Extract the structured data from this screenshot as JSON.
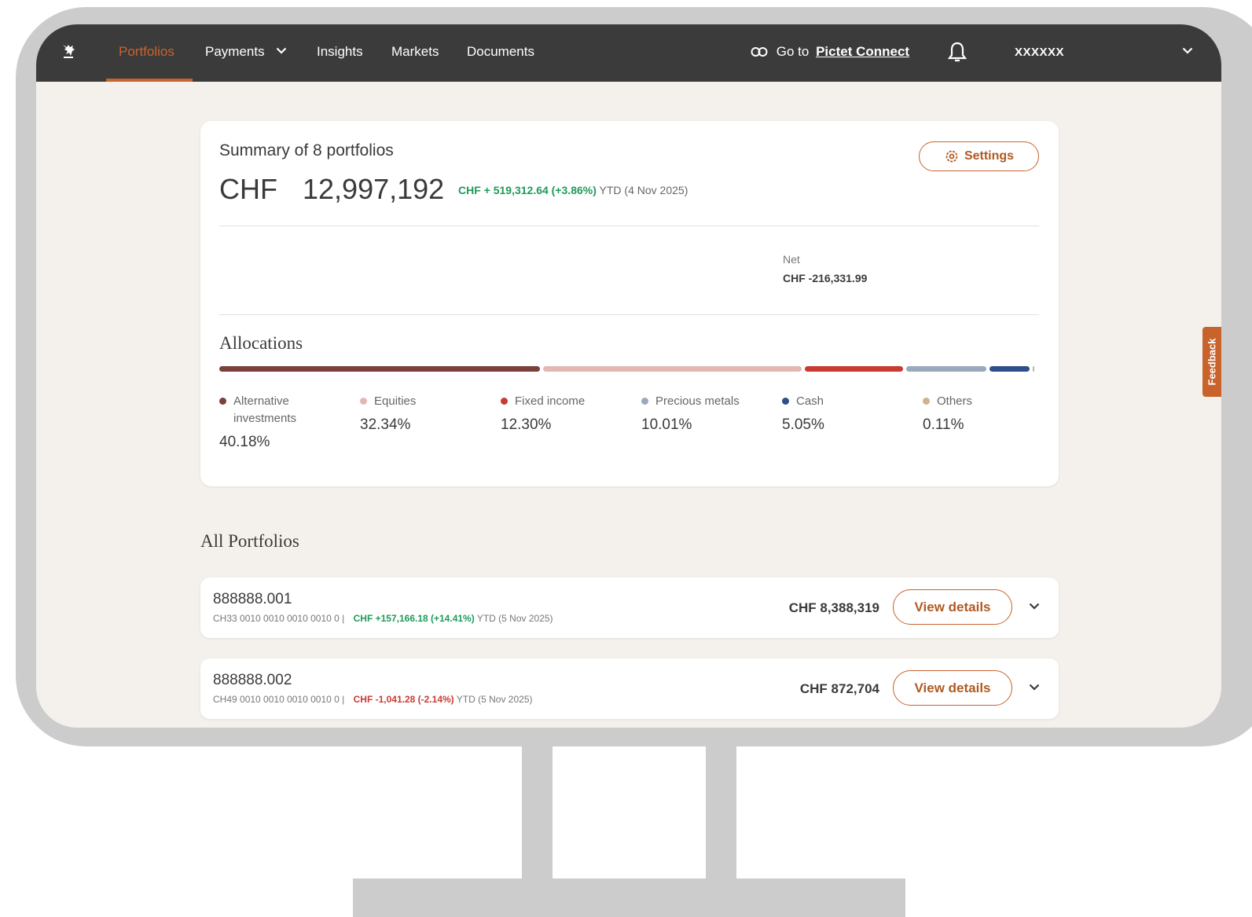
{
  "nav": {
    "items": [
      {
        "label": "Portfolios",
        "active": true
      },
      {
        "label": "Payments"
      },
      {
        "label": "Insights"
      },
      {
        "label": "Markets"
      },
      {
        "label": "Documents"
      }
    ],
    "goto_prefix": "Go to",
    "goto_link": "Pictet Connect",
    "user": "XXXXXX",
    "icons": [
      "logo-icon",
      "chevron-down-icon",
      "link-icon",
      "bell-icon"
    ]
  },
  "summary": {
    "title": "Summary of 8 portfolios",
    "currency": "CHF",
    "total": "12,997,192",
    "ytd_change": "CHF + 519,312.64 (+3.86%)",
    "ytd_suffix": "YTD (4 Nov 2025)",
    "settings_label": "Settings",
    "net_label": "Net",
    "net_value": "CHF -216,331.99"
  },
  "allocations": {
    "title": "Allocations",
    "items": [
      {
        "label": "Alternative investments",
        "pct": "40.18%",
        "value": 40.18,
        "color": "#7a4039"
      },
      {
        "label": "Equities",
        "pct": "32.34%",
        "value": 32.34,
        "color": "#e3b8b3"
      },
      {
        "label": "Fixed income",
        "pct": "12.30%",
        "value": 12.3,
        "color": "#c93a32"
      },
      {
        "label": "Precious metals",
        "pct": "10.01%",
        "value": 10.01,
        "color": "#9aa9bd"
      },
      {
        "label": "Cash",
        "pct": "5.05%",
        "value": 5.05,
        "color": "#2f4f8c"
      },
      {
        "label": "Others",
        "pct": "0.11%",
        "value": 0.11,
        "color": "#cdb48b"
      }
    ]
  },
  "portfolios": {
    "title": "All Portfolios",
    "button_label": "View details",
    "rows": [
      {
        "name": "888888.001",
        "iban": "CH33 0010 0010 0010 0010 0 |",
        "change": "CHF  +157,166.18 (+14.41%)",
        "change_sign": "pos",
        "ytd": "YTD (5 Nov 2025)",
        "value": "CHF 8,388,319"
      },
      {
        "name": "888888.002",
        "iban": "CH49 0010 0010 0010 0010 0 |",
        "change": "CHF  -1,041.28 (-2.14%)",
        "change_sign": "neg",
        "ytd": "YTD (5 Nov 2025)",
        "value": "CHF 872,704"
      }
    ]
  },
  "feedback_label": "Feedback"
}
